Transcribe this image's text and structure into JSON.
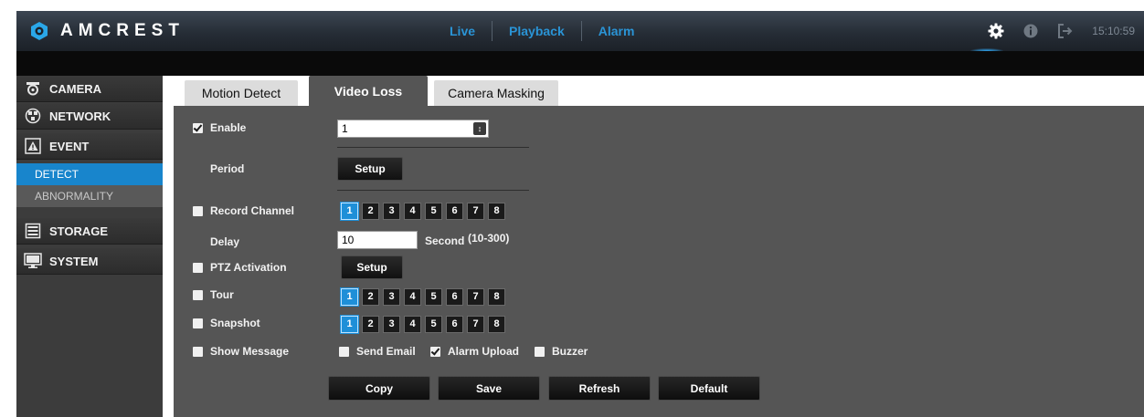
{
  "header": {
    "brand": "AMCREST",
    "nav": [
      {
        "label": "Live"
      },
      {
        "label": "Playback"
      },
      {
        "label": "Alarm"
      }
    ],
    "time": "15:10:59",
    "icons": [
      "gear-icon",
      "info-icon",
      "logout-icon"
    ]
  },
  "sidebar": {
    "sections": [
      {
        "label": "CAMERA",
        "icon": "camera-icon"
      },
      {
        "label": "NETWORK",
        "icon": "network-icon"
      },
      {
        "label": "EVENT",
        "icon": "event-icon"
      },
      {
        "label": "STORAGE",
        "icon": "storage-icon"
      },
      {
        "label": "SYSTEM",
        "icon": "system-icon"
      }
    ],
    "event_items": [
      {
        "label": "DETECT",
        "active": true
      },
      {
        "label": "ABNORMALITY",
        "active": false
      }
    ]
  },
  "tabs": [
    {
      "label": "Motion Detect",
      "active": false
    },
    {
      "label": "Video Loss",
      "active": true
    },
    {
      "label": "Camera Masking",
      "active": false
    }
  ],
  "form": {
    "enable": {
      "label": "Enable",
      "checked": true,
      "value": "1"
    },
    "period": {
      "label": "Period",
      "button": "Setup"
    },
    "record_channel": {
      "label": "Record Channel",
      "checked": false,
      "selected": 1
    },
    "delay": {
      "label": "Delay",
      "value": "10",
      "unit": "Second",
      "range": "(10-300)"
    },
    "ptz": {
      "label": "PTZ Activation",
      "checked": false,
      "button": "Setup"
    },
    "tour": {
      "label": "Tour",
      "checked": false,
      "selected": 1
    },
    "snapshot": {
      "label": "Snapshot",
      "checked": false,
      "selected": 1
    },
    "show_message": {
      "label": "Show Message",
      "checked": false
    },
    "send_email": {
      "label": "Send Email",
      "checked": false
    },
    "alarm_upload": {
      "label": "Alarm Upload",
      "checked": true
    },
    "buzzer": {
      "label": "Buzzer",
      "checked": false
    },
    "channels": [
      "1",
      "2",
      "3",
      "4",
      "5",
      "6",
      "7",
      "8"
    ]
  },
  "buttons": {
    "copy": "Copy",
    "save": "Save",
    "refresh": "Refresh",
    "default": "Default"
  },
  "colors": {
    "accent": "#1e8fd8",
    "nav_text": "#2a94d6",
    "panel_bg": "#555555",
    "sidebar_bg": "#3c3c3c"
  }
}
